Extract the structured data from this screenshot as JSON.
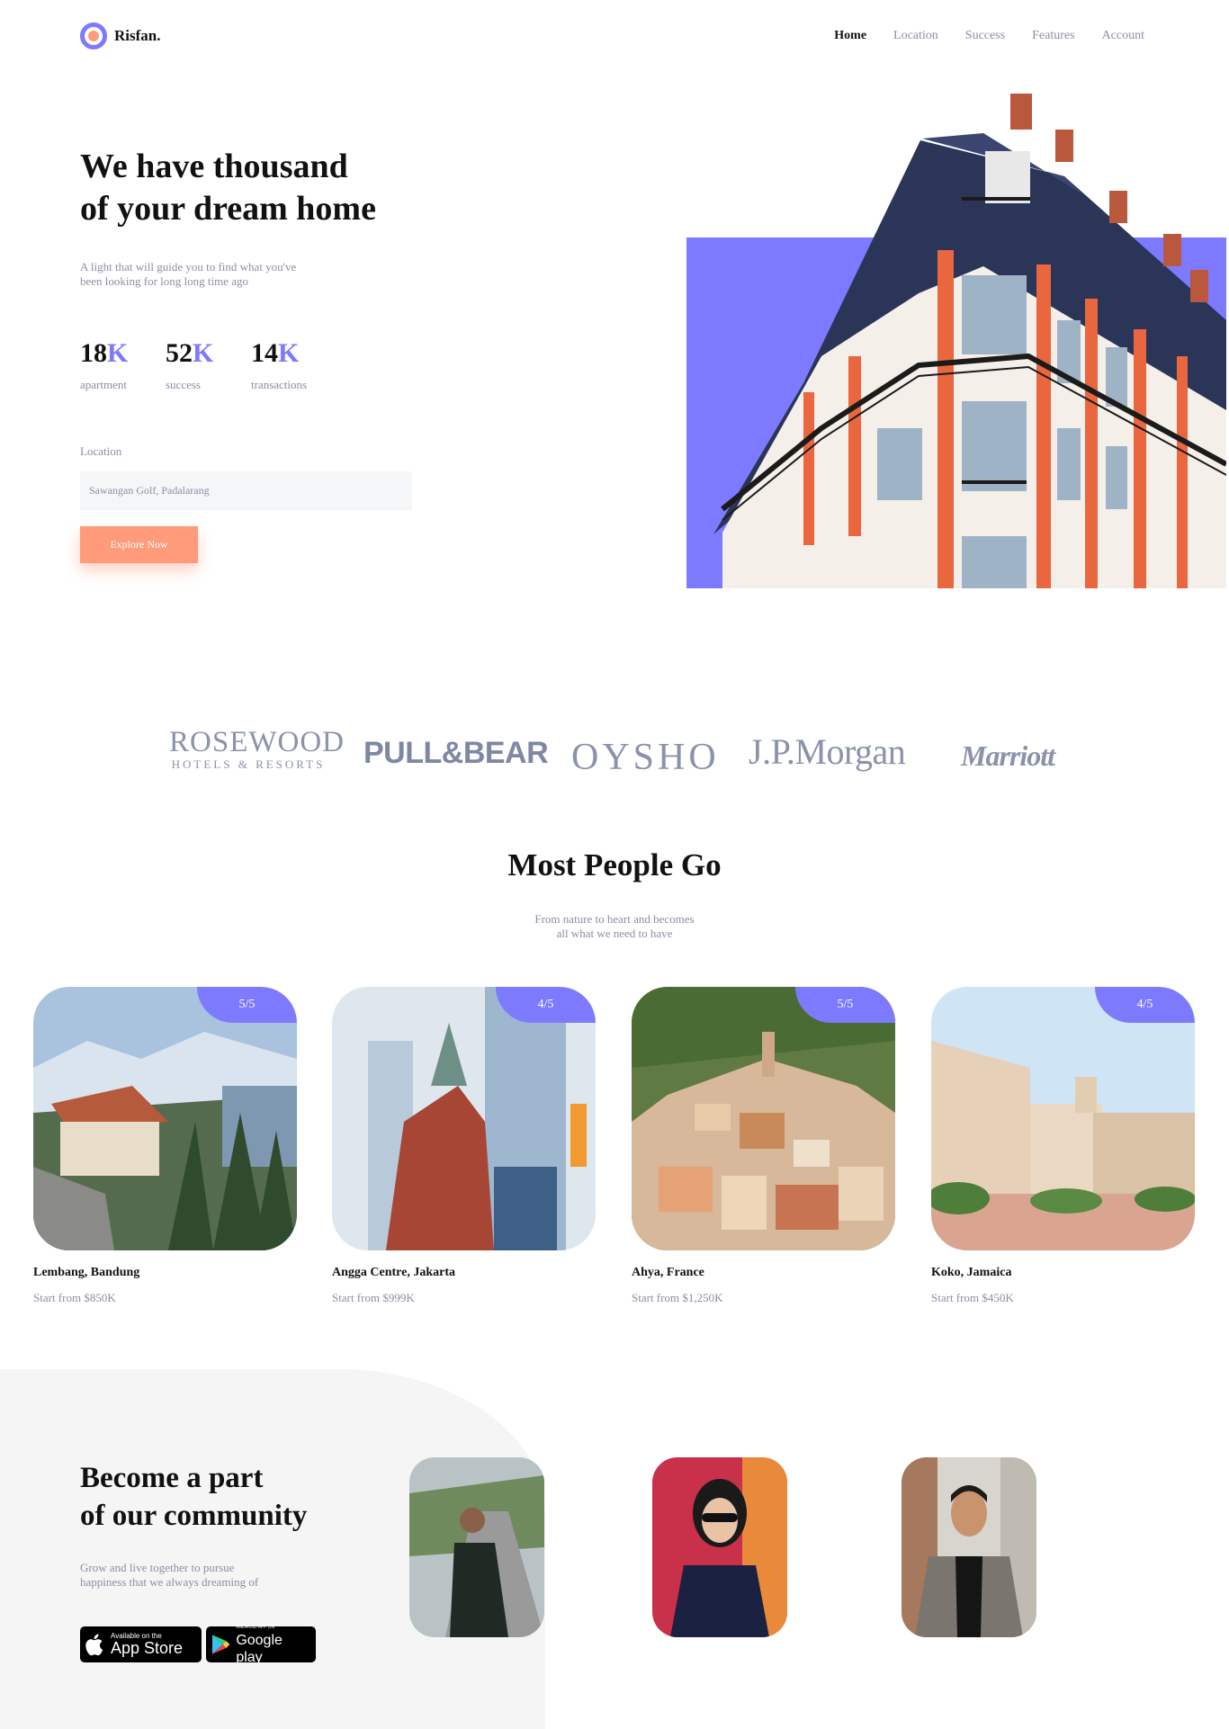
{
  "brand": {
    "name": "Risfan."
  },
  "nav": {
    "items": [
      "Home",
      "Location",
      "Success",
      "Features",
      "Account"
    ],
    "active": "Home"
  },
  "hero": {
    "title_line1": "We have thousand",
    "title_line2": "of your dream home",
    "subtitle_line1": "A light that will guide you to find what you've",
    "subtitle_line2": "been looking for long long time ago",
    "stats": [
      {
        "value": "18",
        "suffix": "K",
        "label": "apartment"
      },
      {
        "value": "52",
        "suffix": "K",
        "label": "success"
      },
      {
        "value": "14",
        "suffix": "K",
        "label": "transactions"
      }
    ],
    "location_label": "Location",
    "location_value": "Sawangan Golf, Padalarang",
    "cta": "Explore Now"
  },
  "partners": {
    "rosewood_line1": "ROSEWOOD",
    "rosewood_line2": "HOTELS & RESORTS",
    "pullbear": "PULL&BEAR",
    "oysho": "OYSHO",
    "jpmorgan": "J.P.Morgan",
    "marriott": "Marriott"
  },
  "popular": {
    "title": "Most People Go",
    "subtitle_line1": "From nature to heart and becomes",
    "subtitle_line2": "all what we need to have",
    "cards": [
      {
        "name": "Lembang, Bandung",
        "price": "Start from $850K",
        "rating": "5/5"
      },
      {
        "name": "Angga Centre, Jakarta",
        "price": "Start from $999K",
        "rating": "4/5"
      },
      {
        "name": "Ahya, France",
        "price": "Start from $1,250K",
        "rating": "5/5"
      },
      {
        "name": "Koko, Jamaica",
        "price": "Start from $450K",
        "rating": "4/5"
      }
    ]
  },
  "community": {
    "title_line1": "Become a part",
    "title_line2": "of our community",
    "subtitle_line1": "Grow and live together to pursue",
    "subtitle_line2": "happiness that we always dreaming of",
    "appstore_small": "Available on the",
    "appstore_big": "App Store",
    "googleplay_small": "ANDROID APP ON",
    "googleplay_big": "Google play"
  },
  "colors": {
    "accent": "#7d7aff",
    "cta": "#ff9a7b",
    "muted": "#8a8fa3",
    "logo": "#8a93ab"
  }
}
